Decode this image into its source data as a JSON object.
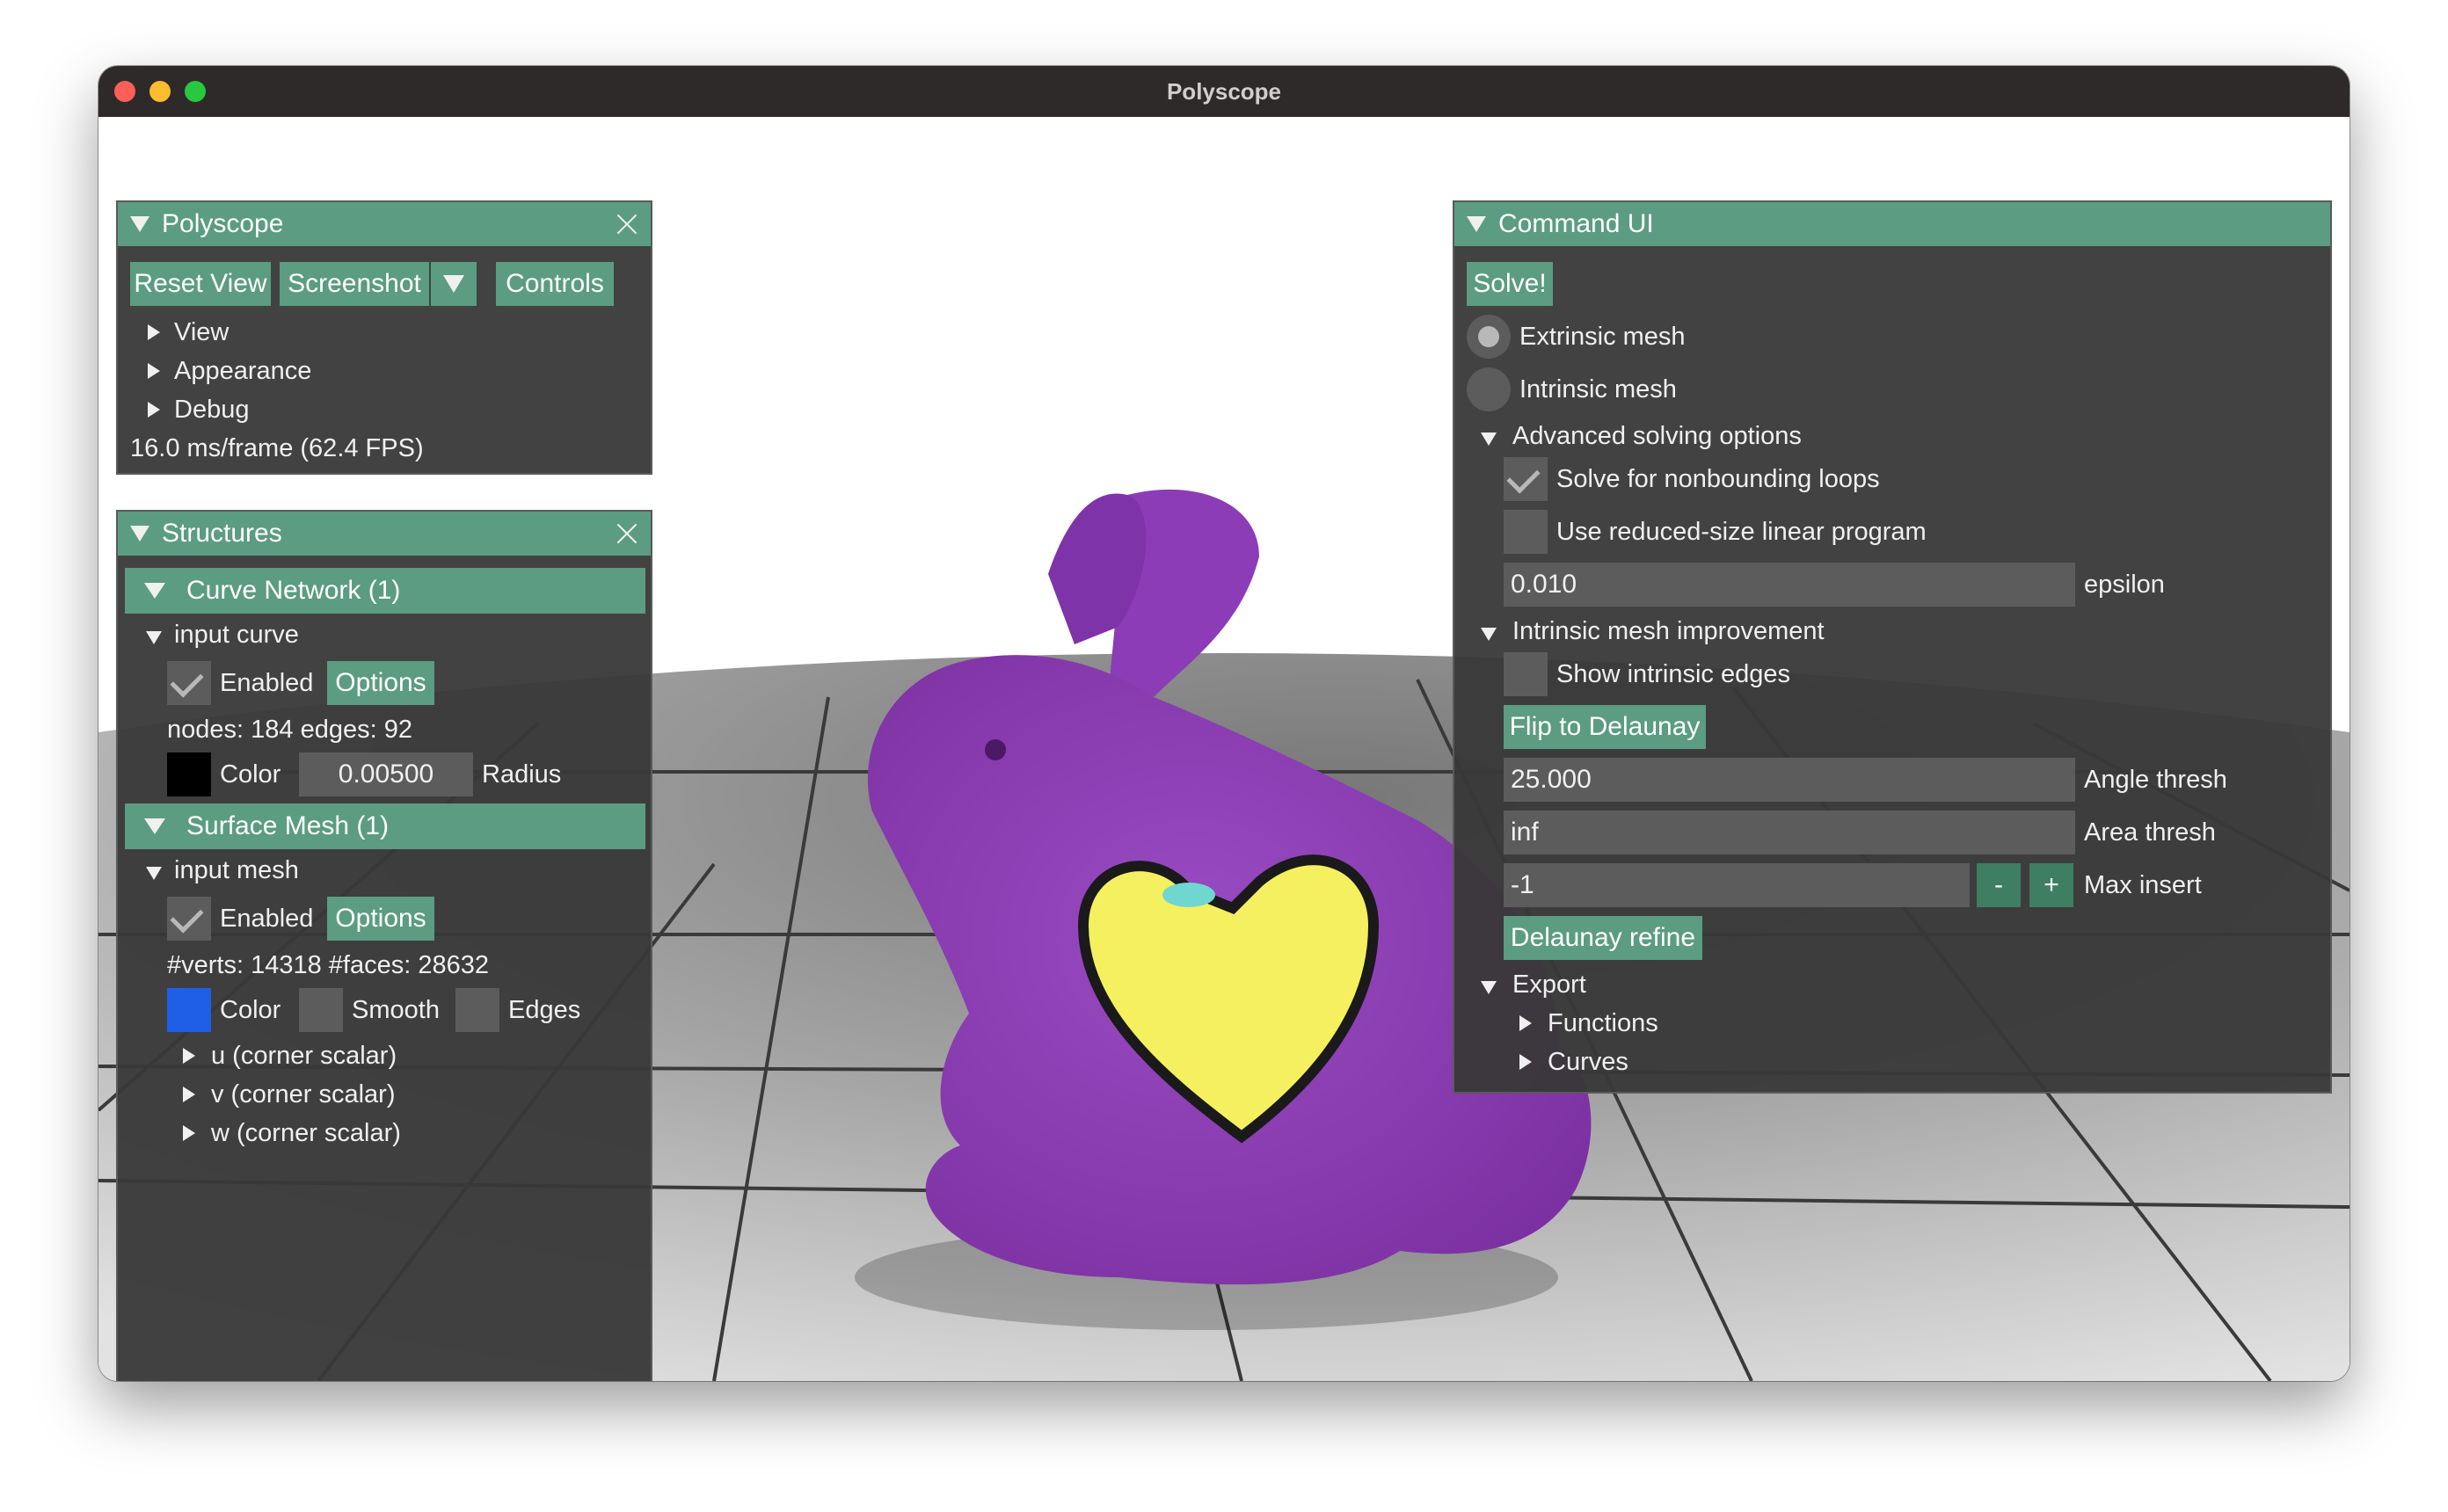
{
  "window": {
    "title": "Polyscope"
  },
  "polyscope_panel": {
    "title": "Polyscope",
    "buttons": {
      "reset_view": "Reset View",
      "screenshot": "Screenshot",
      "controls": "Controls"
    },
    "tree": {
      "view": "View",
      "appearance": "Appearance",
      "debug": "Debug"
    },
    "fps": "16.0 ms/frame (62.4 FPS)"
  },
  "structures_panel": {
    "title": "Structures",
    "curve_network": {
      "header": "Curve Network (1)",
      "item": "input curve",
      "enabled": "Enabled",
      "options": "Options",
      "stats": "nodes: 184  edges: 92",
      "color_label": "Color",
      "color": "#000000",
      "radius_value": "0.00500",
      "radius_label": "Radius"
    },
    "surface_mesh": {
      "header": "Surface Mesh (1)",
      "item": "input mesh",
      "enabled": "Enabled",
      "options": "Options",
      "stats": "#verts: 14318  #faces: 28632",
      "color_label": "Color",
      "color": "#1f5fe8",
      "smooth_label": "Smooth",
      "edges_label": "Edges",
      "quantities": [
        "u (corner scalar)",
        "v (corner scalar)",
        "w (corner scalar)"
      ]
    }
  },
  "command_panel": {
    "title": "Command UI",
    "solve": "Solve!",
    "radio": {
      "extrinsic": "Extrinsic mesh",
      "intrinsic": "Intrinsic mesh"
    },
    "advanced": {
      "header": "Advanced solving options",
      "nonbounding": "Solve for nonbounding loops",
      "reduced": "Use reduced-size linear program",
      "epsilon_value": "0.010",
      "epsilon_label": "epsilon"
    },
    "improvement": {
      "header": "Intrinsic mesh improvement",
      "show_edges": "Show intrinsic edges",
      "flip": "Flip to Delaunay",
      "angle_value": "25.000",
      "angle_label": "Angle thresh",
      "area_value": "inf",
      "area_label": "Area thresh",
      "max_value": "-1",
      "minus": "-",
      "plus": "+",
      "max_label": "Max insert",
      "refine": "Delaunay refine"
    },
    "export": {
      "header": "Export",
      "functions": "Functions",
      "curves": "Curves"
    }
  },
  "colors": {
    "accent": "#5b9c82",
    "panel_bg": "#383838",
    "mesh": "#8a3fb0",
    "heart": "#f4f060"
  },
  "icons": [
    "close-icon",
    "triangle-down-icon",
    "triangle-right-icon",
    "checkmark-icon",
    "resize-grip-icon"
  ]
}
